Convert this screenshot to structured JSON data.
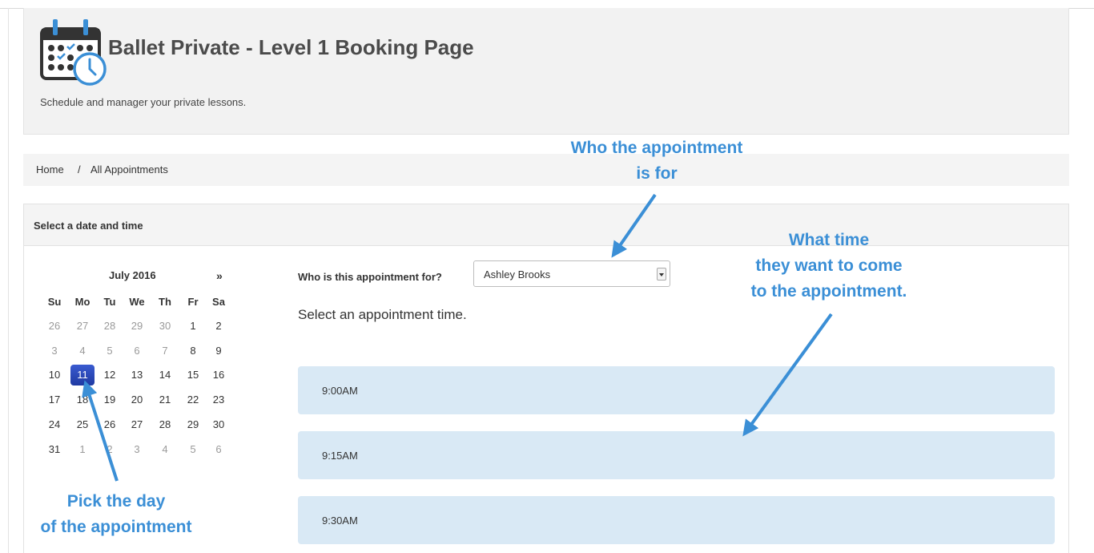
{
  "header": {
    "title": "Ballet Private - Level 1 Booking Page",
    "subtitle": "Schedule and manager your private lessons.",
    "logo_icon": "calendar-clock-icon"
  },
  "breadcrumb": {
    "home": "Home",
    "separator": "/",
    "current": "All Appointments"
  },
  "panel": {
    "title": "Select a date and time"
  },
  "calendar": {
    "month_label": "July 2016",
    "next_label": "»",
    "weekdays": [
      "Su",
      "Mo",
      "Tu",
      "We",
      "Th",
      "Fr",
      "Sa"
    ],
    "weeks": [
      [
        "26",
        "27",
        "28",
        "29",
        "30",
        "1",
        "2"
      ],
      [
        "3",
        "4",
        "5",
        "6",
        "7",
        "8",
        "9"
      ],
      [
        "10",
        "11",
        "12",
        "13",
        "14",
        "15",
        "16"
      ],
      [
        "17",
        "18",
        "19",
        "20",
        "21",
        "22",
        "23"
      ],
      [
        "24",
        "25",
        "26",
        "27",
        "28",
        "29",
        "30"
      ],
      [
        "31",
        "1",
        "2",
        "3",
        "4",
        "5",
        "6"
      ]
    ],
    "selected_day": "11",
    "selected_color": "#2745b5"
  },
  "form": {
    "who_label": "Who is this appointment for?",
    "who_value": "Ashley Brooks",
    "select_time_heading": "Select an appointment time."
  },
  "time_slots": [
    "9:00AM",
    "9:15AM",
    "9:30AM"
  ],
  "annotations": {
    "who_line1": "Who the appointment",
    "who_line2": "is for",
    "time_line1": "What time",
    "time_line2": "they want to come",
    "time_line3": "to the appointment.",
    "day_line1": "Pick the day",
    "day_line2": "of the appointment",
    "color": "#3b8fd6"
  }
}
